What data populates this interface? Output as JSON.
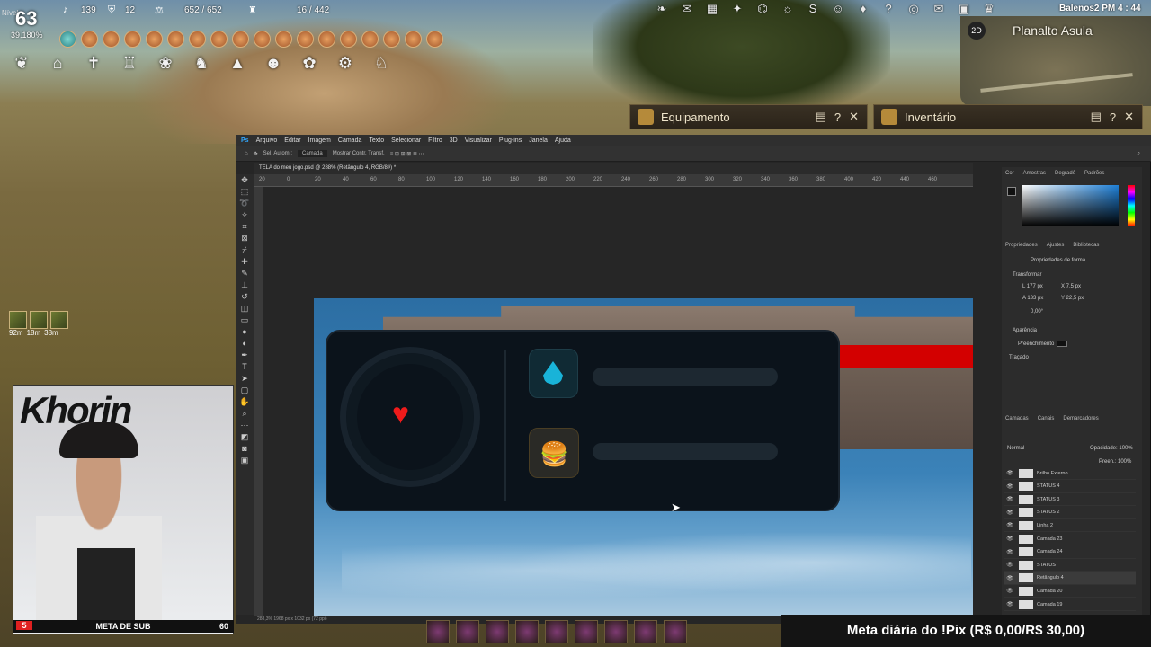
{
  "hud": {
    "level_label": "Nível",
    "level": "63",
    "xp_percent": "39.180%",
    "contribution": "139",
    "defense": "12",
    "weight": "652 / 652",
    "inventory": "16 / 442",
    "user": "Balenos2 PM 4 : 44",
    "minimap_region": "Planalto Asula",
    "minimap_mode": "2D"
  },
  "panels": {
    "equipment": "Equipamento",
    "inventory": "Inventário"
  },
  "left_buffs": {
    "timers": [
      "92m",
      "18m",
      "38m"
    ]
  },
  "photoshop": {
    "menu": [
      "Arquivo",
      "Editar",
      "Imagem",
      "Camada",
      "Texto",
      "Selecionar",
      "Filtro",
      "3D",
      "Visualizar",
      "Plug-ins",
      "Janela",
      "Ajuda"
    ],
    "document_tab": "TELA do meu jogo.psd @ 288% (Retângulo 4, RGB/8#) *",
    "options": [
      "Sel. Autom.:",
      "Camada",
      "Mostrar Contr. Transf."
    ],
    "ruler_ticks": [
      "20",
      "0",
      "20",
      "40",
      "60",
      "80",
      "100",
      "120",
      "140",
      "160",
      "180",
      "200",
      "220",
      "240",
      "260",
      "280",
      "300",
      "320",
      "340",
      "360",
      "380",
      "400",
      "420",
      "440",
      "460"
    ],
    "color_tabs": [
      "Cor",
      "Amostras",
      "Degradê",
      "Padrões"
    ],
    "props_tabs": [
      "Propriedades",
      "Ajustes",
      "Bibliotecas"
    ],
    "props_title": "Propriedades de forma",
    "transform": "Transformar",
    "w": "L 177 px",
    "x": "X 7,5 px",
    "h": "A 133 px",
    "y": "Y 22,5 px",
    "angle": "0,00°",
    "appearance": "Aparência",
    "fill": "Preenchimento",
    "stroke": "Traçado",
    "layers_tabs": [
      "Camadas",
      "Canais",
      "Demarcadores"
    ],
    "layers": [
      "Brilho Externo",
      "STATUS 4",
      "STATUS 3",
      "STATUS 2",
      "Linha 2",
      "Camada 23",
      "Camada 24",
      "STATUS",
      "Retângulo 4",
      "Camada 20",
      "Camada 19"
    ],
    "selected_layer": "Retângulo 4",
    "blend": "Normal",
    "opacity": "Opacidade: 100%",
    "fill_pct": "Preen.: 100%",
    "status": "288,3%    1968 px x 1032 px (72 ppi)"
  },
  "webcam": {
    "logo": "Khorin",
    "sub_count_left": "5",
    "sub_label": "META DE SUB",
    "sub_count_right": "60"
  },
  "pix_goal": "Meta diária do !Pix (R$ 0,00/R$ 30,00)",
  "colors": {
    "accent_red": "#d30000",
    "heart": "#ef1b1b",
    "drop": "#19b3d8"
  }
}
